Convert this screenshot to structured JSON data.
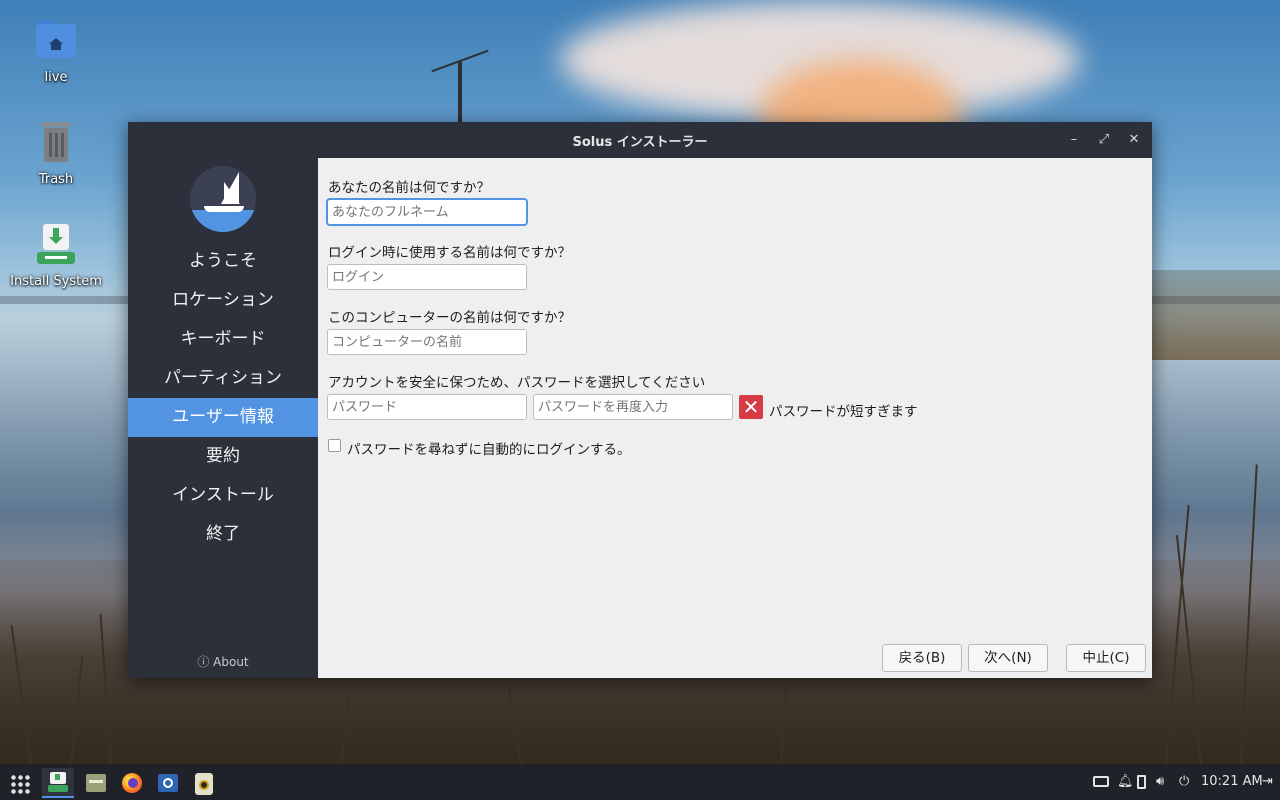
{
  "desktop": {
    "icons": [
      {
        "label": "live",
        "icon": "home-folder-icon"
      },
      {
        "label": "Trash",
        "icon": "trash-icon"
      },
      {
        "label": "Install System",
        "icon": "install-system-icon"
      }
    ]
  },
  "window": {
    "title": "Solus インストーラー",
    "controls": {
      "minimize": "–",
      "maximize": "⤢",
      "close": "✕"
    }
  },
  "sidebar": {
    "items": [
      {
        "label": "ようこそ",
        "active": false
      },
      {
        "label": "ロケーション",
        "active": false
      },
      {
        "label": "キーボード",
        "active": false
      },
      {
        "label": "パーティション",
        "active": false
      },
      {
        "label": "ユーザー情報",
        "active": true
      },
      {
        "label": "要約",
        "active": false
      },
      {
        "label": "インストール",
        "active": false
      },
      {
        "label": "終了",
        "active": false
      }
    ],
    "about": "ⓘ About"
  },
  "form": {
    "name_question": "あなたの名前は何ですか？",
    "name_placeholder": "あなたのフルネーム",
    "login_question": "ログイン時に使用する名前は何ですか？",
    "login_placeholder": "ログイン",
    "computer_question": "このコンピューターの名前は何ですか？",
    "computer_placeholder": "コンピューターの名前",
    "password_question": "アカウントを安全に保つため、パスワードを選択してください",
    "password_placeholder": "パスワード",
    "password_confirm_placeholder": "パスワードを再度入力",
    "password_error": "パスワードが短すぎます",
    "autologin_label": "パスワードを尋ねずに自動的にログインする。",
    "autologin_checked": false
  },
  "buttons": {
    "back": "戻る(B)",
    "next": "次へ(N)",
    "cancel": "中止(C)"
  },
  "taskbar": {
    "apps": [
      "app-menu-icon",
      "installer-icon",
      "files-icon",
      "firefox-icon",
      "software-center-icon",
      "rhythmbox-icon"
    ],
    "clock": "10:21 AM"
  },
  "colors": {
    "accent": "#5294e2",
    "sidebar_bg": "#2c303a",
    "error": "#d63b45"
  }
}
